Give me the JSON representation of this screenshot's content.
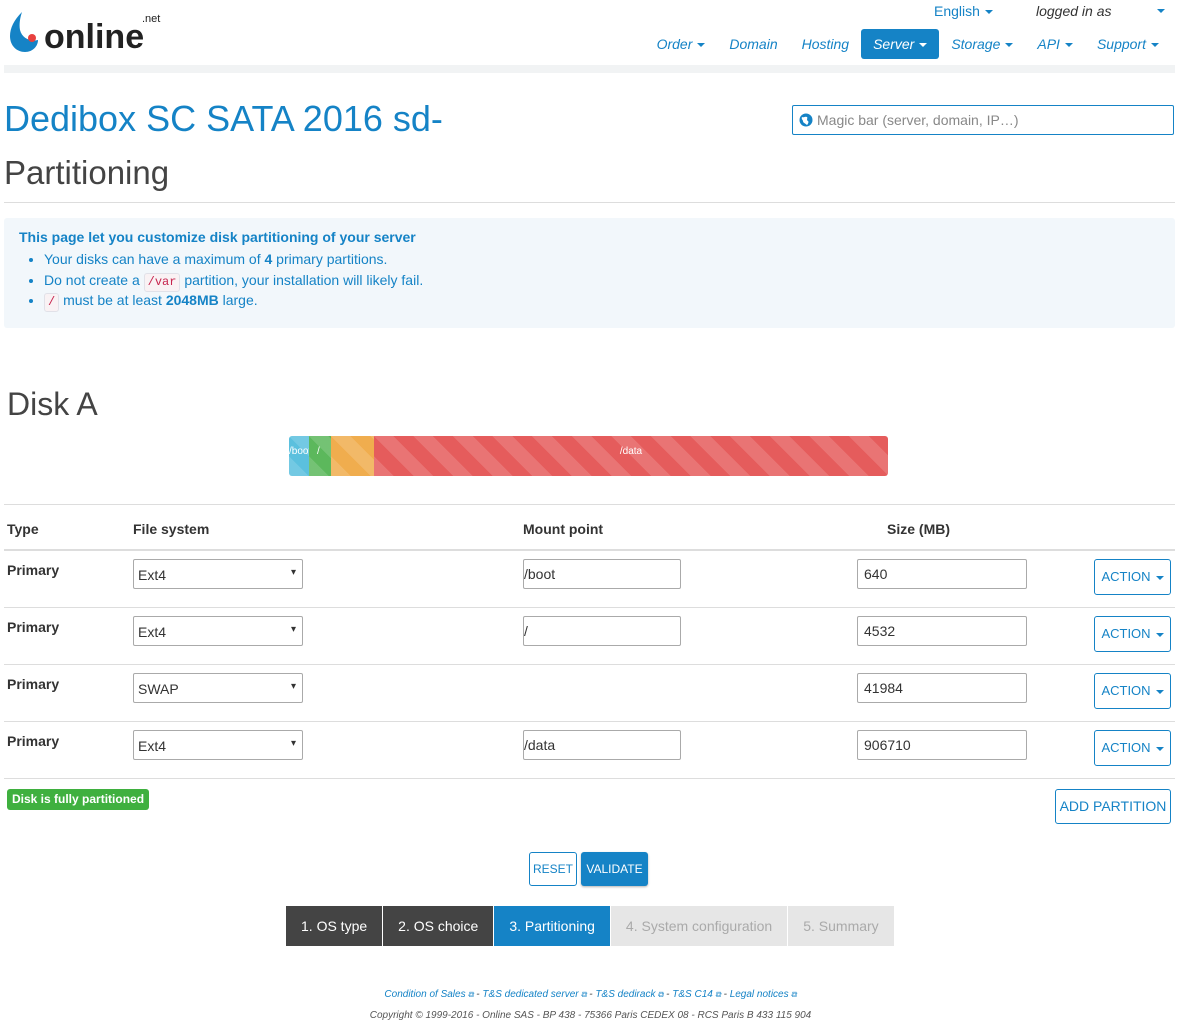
{
  "header": {
    "logo_text": "online",
    "logo_suffix": ".net",
    "language": "English",
    "logged_in": "logged in as",
    "nav": [
      {
        "label": "Order",
        "caret": true
      },
      {
        "label": "Domain",
        "caret": false
      },
      {
        "label": "Hosting",
        "caret": false
      },
      {
        "label": "Server",
        "caret": true,
        "active": true
      },
      {
        "label": "Storage",
        "caret": true
      },
      {
        "label": "API",
        "caret": true
      },
      {
        "label": "Support",
        "caret": true
      }
    ],
    "magic_placeholder": "Magic bar (server, domain, IP…)"
  },
  "page": {
    "title": "Dedibox SC SATA 2016 sd-",
    "subtitle": "Partitioning"
  },
  "info": {
    "heading": "This page let you customize disk partitioning of your server",
    "line1_pre": "Your disks can have a maximum of",
    "line1_num": "4",
    "line1_post": "primary partitions.",
    "line2_pre": "Do not create a",
    "line2_code": "/var",
    "line2_post": "partition, your installation will likely fail.",
    "line3_code": "/",
    "line3_mid": "must be at least",
    "line3_size": "2048MB",
    "line3_post": "large."
  },
  "disk": {
    "title": "Disk A",
    "bar": [
      {
        "label": "/boot",
        "size": 640,
        "color": "#5bc0de"
      },
      {
        "label": "/",
        "size": 4532,
        "color": "#5cb85c"
      },
      {
        "label": "",
        "size": 41984,
        "color": "#f0ad4e"
      },
      {
        "label": "/data",
        "size": 906710,
        "color": "#e55c5c"
      }
    ]
  },
  "table": {
    "headers": {
      "type": "Type",
      "fs": "File system",
      "mount": "Mount point",
      "size": "Size (MB)"
    },
    "rows": [
      {
        "type": "Primary",
        "fs": "Ext4",
        "mount": "/boot",
        "size": "640",
        "action": "ACTION",
        "has_mount": true
      },
      {
        "type": "Primary",
        "fs": "Ext4",
        "mount": "/",
        "size": "4532",
        "action": "ACTION",
        "has_mount": true
      },
      {
        "type": "Primary",
        "fs": "SWAP",
        "mount": "",
        "size": "41984",
        "action": "ACTION",
        "has_mount": false
      },
      {
        "type": "Primary",
        "fs": "Ext4",
        "mount": "/data",
        "size": "906710",
        "action": "ACTION",
        "has_mount": true
      }
    ]
  },
  "status_badge": "Disk is fully partitioned",
  "add_partition": "ADD PARTITION",
  "reset": "RESET",
  "validate": "VALIDATE",
  "steps": [
    {
      "label": "1. OS type",
      "state": "done"
    },
    {
      "label": "2. OS choice",
      "state": "done"
    },
    {
      "label": "3. Partitioning",
      "state": "cur"
    },
    {
      "label": "4. System configuration",
      "state": "todo"
    },
    {
      "label": "5. Summary",
      "state": "todo"
    }
  ],
  "footer": {
    "links": [
      "Condition of Sales",
      "T&S dedicated server",
      "T&S dedirack",
      "T&S C14",
      "Legal notices"
    ],
    "copyright": "Copyright © 1999-2016 - Online SAS - BP 438 - 75366 Paris CEDEX 08 - RCS Paris B 433 115 904"
  },
  "colors": {
    "accent": "#1583c6",
    "success": "#3fb03f",
    "dark_step": "#444444"
  }
}
